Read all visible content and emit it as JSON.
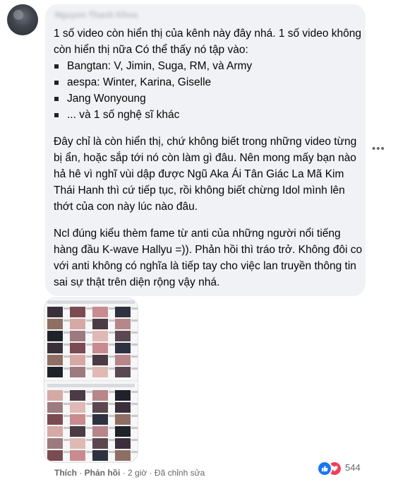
{
  "comment": {
    "author": "Nguyen Thanh Khoa",
    "intro": "1 số video còn hiển thị của kênh này đây nhá. 1 số video không còn hiển thị nữa Có thể thấy nó tập vào:",
    "list": [
      "Bangtan: V, Jimin, Suga, RM, và Army",
      " aespa: Winter, Karina, Giselle",
      "Jang Wonyoung",
      "... và 1 số nghệ sĩ khác"
    ],
    "paragraph2": "Đây chỉ là còn hiển thị, chứ không biết trong những video từng bị ẩn, hoặc sắp tới nó còn làm gì đâu. Nên mong mấy bạn nào hả hê vì nghĩ vùi dập được Ngũ Aka Ái Tân Giác La Mã Kim Thái Hanh thì cứ tiếp tục, rồi không biết chừng Idol mình lên thớt của con này lúc nào đâu.",
    "paragraph3": "Ncl đúng kiểu thèm fame từ anti của những người nổi tiếng hàng đầu K-wave Hallyu =)). Phản hồi thì tráo trở. Không đôi co với anti không có nghĩa là tiếp tay cho việc lan truyền thông tin sai sự thật trên diện rộng vậy nhá.",
    "more_icon": "more-horizontal-icon"
  },
  "actions": {
    "like": "Thích",
    "sep1": " · ",
    "reply": "Phản hồi",
    "sep2": " · ",
    "time": "2 giờ",
    "sep3": " · ",
    "edited": "Đã chỉnh sửa"
  },
  "reactions": {
    "icons": [
      "like-icon",
      "love-icon"
    ],
    "count": "544",
    "colors": {
      "like": "#1877f2",
      "love": "#f33e58"
    }
  },
  "colors": {
    "bubble": "#f0f2f5",
    "meta": "#65676b",
    "text": "#050505"
  }
}
